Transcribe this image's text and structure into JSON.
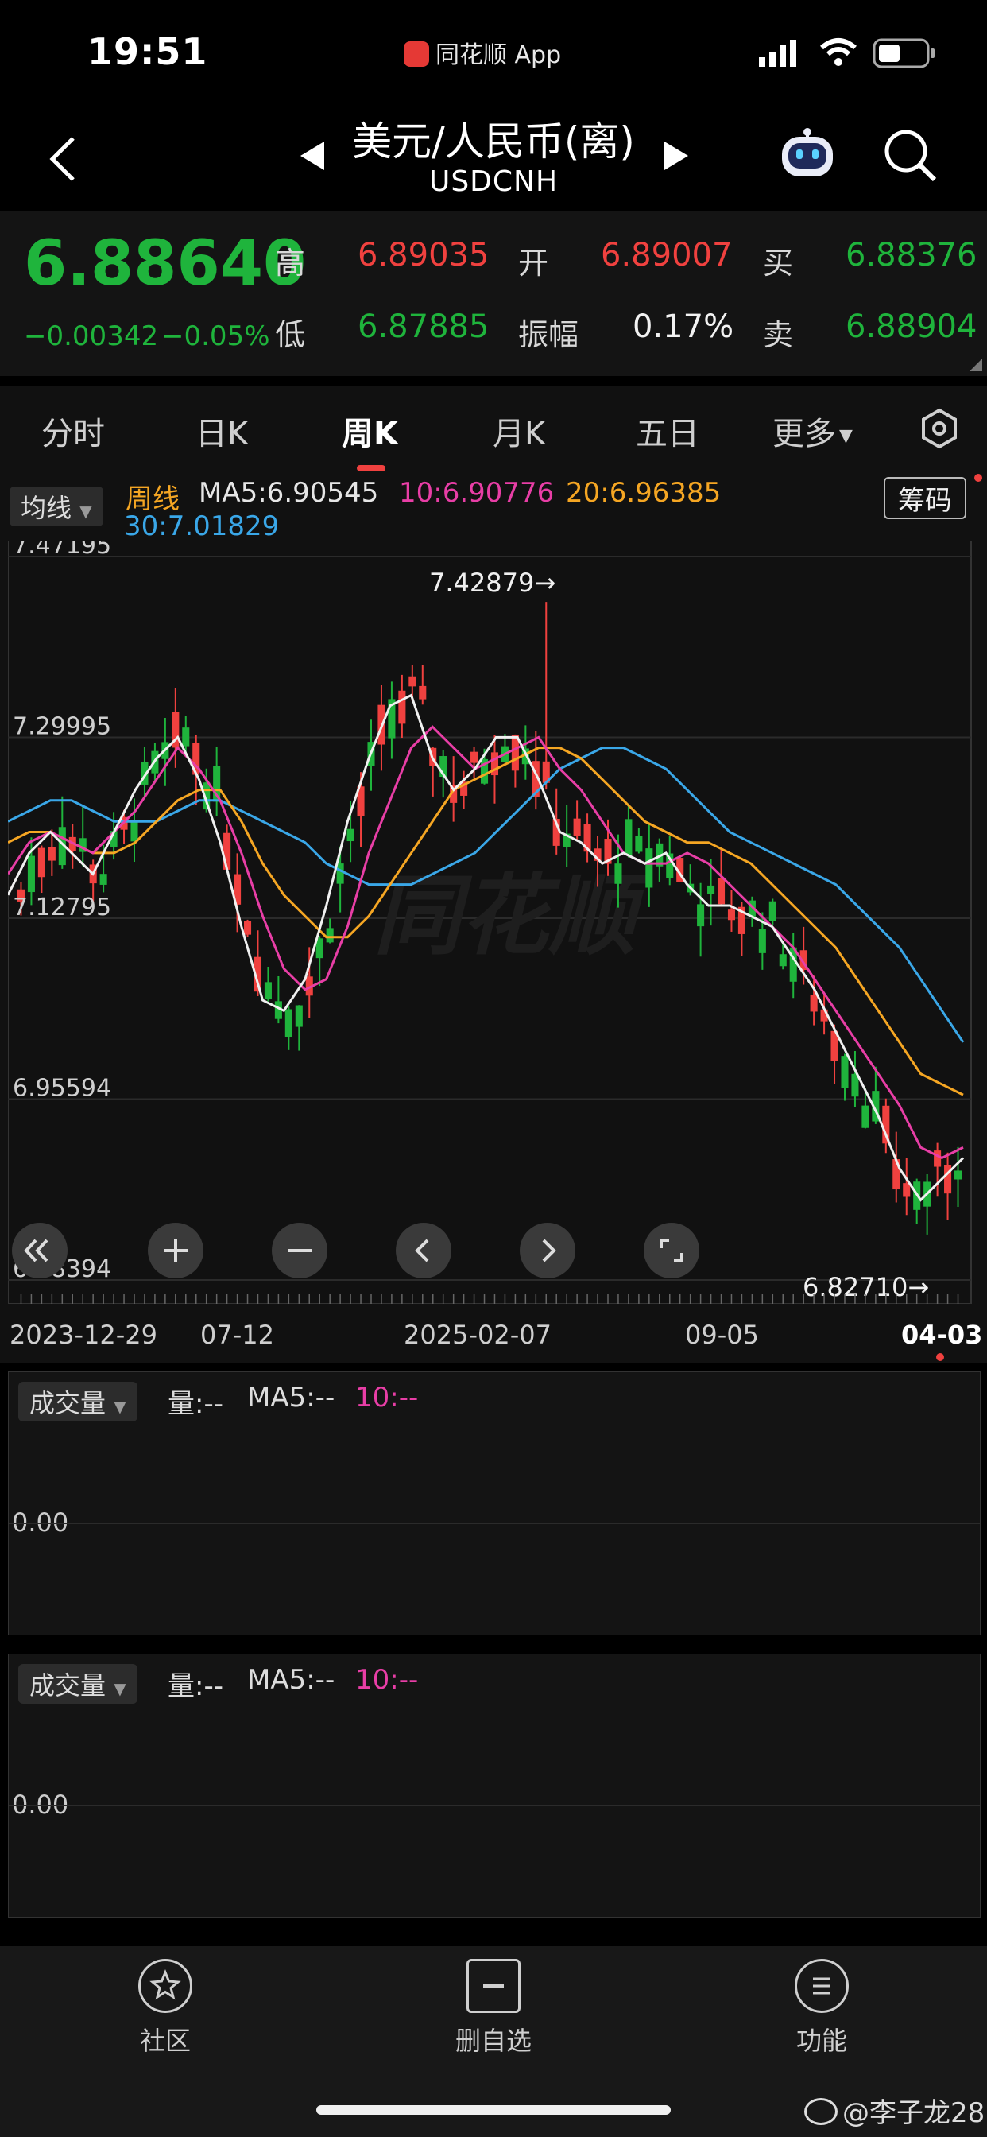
{
  "status": {
    "time": "19:51",
    "app": "同花顺 App"
  },
  "header": {
    "title": "美元/人民币(离)",
    "code": "USDCNH"
  },
  "quote": {
    "price": "6.88640",
    "change": "−0.00342",
    "change_pct": "−0.05%",
    "high_label": "高",
    "high": "6.89035",
    "low_label": "低",
    "low": "6.87885",
    "open_label": "开",
    "open": "6.89007",
    "amp_label": "振幅",
    "amp": "0.17%",
    "buy_label": "买",
    "buy": "6.88376",
    "sell_label": "卖",
    "sell": "6.88904"
  },
  "tabs": [
    {
      "label": "分时"
    },
    {
      "label": "日K"
    },
    {
      "label": "周K",
      "active": true
    },
    {
      "label": "月K"
    },
    {
      "label": "五日"
    },
    {
      "label": "更多"
    }
  ],
  "ma": {
    "selector": "均线",
    "period": "周线",
    "ma5": "MA5:6.90545",
    "ma10": "10:6.90776",
    "ma20": "20:6.96385",
    "ma30": "30:7.01829",
    "chips_button": "筹码"
  },
  "chart_data": {
    "type": "candlestick",
    "y_ticks": [
      "7.47195",
      "7.29995",
      "7.12795",
      "6.95594",
      "6.78394"
    ],
    "ylim": [
      6.78394,
      7.47195
    ],
    "x_ticks": [
      "2023-12-29",
      "07-12",
      "2025-02-07",
      "09-05",
      "04-03"
    ],
    "max_annotation": "7.42879→",
    "min_annotation": "6.82710→",
    "watermark": "同花顺",
    "series_colors": {
      "ma5": "#f0f0f0",
      "ma10": "#e83ea6",
      "ma20": "#f5a623",
      "ma30": "#3aa7e8",
      "up": "#f0413f",
      "down": "#1fb43c"
    },
    "ma30": [
      7.22,
      7.23,
      7.24,
      7.24,
      7.23,
      7.22,
      7.22,
      7.22,
      7.23,
      7.24,
      7.24,
      7.23,
      7.22,
      7.21,
      7.2,
      7.18,
      7.17,
      7.16,
      7.16,
      7.16,
      7.17,
      7.18,
      7.19,
      7.21,
      7.23,
      7.25,
      7.27,
      7.28,
      7.29,
      7.29,
      7.28,
      7.27,
      7.25,
      7.23,
      7.21,
      7.2,
      7.19,
      7.18,
      7.17,
      7.16,
      7.14,
      7.12,
      7.1,
      7.07,
      7.04,
      7.01
    ],
    "ma20": [
      7.2,
      7.21,
      7.21,
      7.2,
      7.19,
      7.19,
      7.2,
      7.22,
      7.24,
      7.25,
      7.25,
      7.22,
      7.18,
      7.15,
      7.13,
      7.11,
      7.11,
      7.13,
      7.16,
      7.19,
      7.22,
      7.25,
      7.26,
      7.27,
      7.28,
      7.29,
      7.29,
      7.28,
      7.26,
      7.24,
      7.22,
      7.21,
      7.2,
      7.2,
      7.19,
      7.18,
      7.16,
      7.14,
      7.12,
      7.1,
      7.07,
      7.04,
      7.01,
      6.98,
      6.97,
      6.96
    ],
    "ma10": [
      7.17,
      7.2,
      7.21,
      7.2,
      7.19,
      7.21,
      7.23,
      7.26,
      7.29,
      7.27,
      7.24,
      7.19,
      7.13,
      7.08,
      7.06,
      7.07,
      7.12,
      7.19,
      7.24,
      7.29,
      7.31,
      7.29,
      7.27,
      7.28,
      7.29,
      7.3,
      7.27,
      7.25,
      7.22,
      7.19,
      7.18,
      7.18,
      7.19,
      7.18,
      7.16,
      7.14,
      7.12,
      7.1,
      7.07,
      7.04,
      7.01,
      6.98,
      6.95,
      6.91,
      6.9,
      6.91
    ],
    "ma5": [
      7.15,
      7.19,
      7.21,
      7.19,
      7.17,
      7.21,
      7.25,
      7.28,
      7.3,
      7.26,
      7.2,
      7.12,
      7.05,
      7.04,
      7.07,
      7.14,
      7.22,
      7.28,
      7.33,
      7.34,
      7.28,
      7.25,
      7.27,
      7.3,
      7.3,
      7.26,
      7.21,
      7.2,
      7.18,
      7.19,
      7.18,
      7.19,
      7.16,
      7.14,
      7.14,
      7.13,
      7.12,
      7.09,
      7.06,
      7.02,
      6.98,
      6.94,
      6.89,
      6.86,
      6.88,
      6.9
    ]
  },
  "volume_panes": [
    {
      "selector": "成交量",
      "vol": "量:--",
      "ma5": "MA5:--",
      "ma10": "10:--",
      "zero": "0.00"
    },
    {
      "selector": "成交量",
      "vol": "量:--",
      "ma5": "MA5:--",
      "ma10": "10:--",
      "zero": "0.00"
    }
  ],
  "bottom_nav": [
    {
      "label": "社区",
      "icon": "community-star-icon"
    },
    {
      "label": "删自选",
      "icon": "remove-watchlist-icon"
    },
    {
      "label": "功能",
      "icon": "menu-icon"
    }
  ],
  "watermark_user": "@李子龙28"
}
